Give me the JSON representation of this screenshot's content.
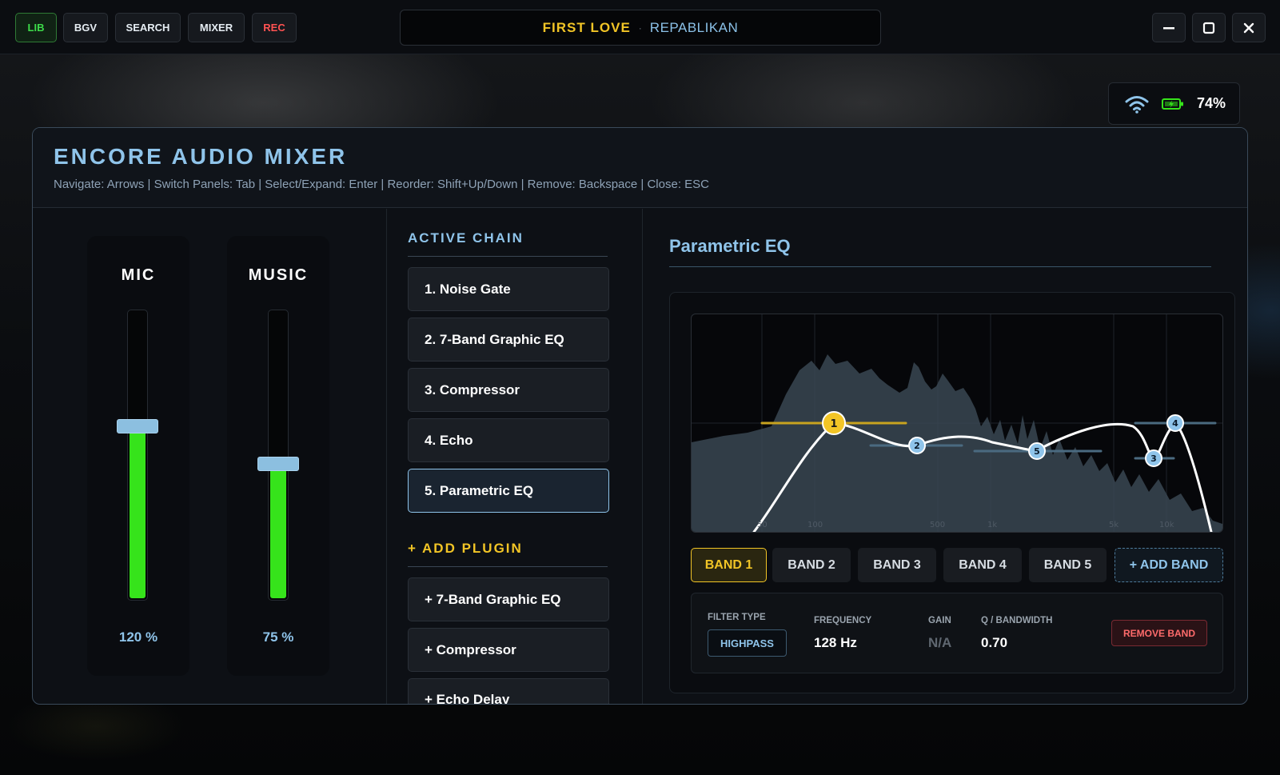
{
  "topbar": {
    "nav": [
      "LIB",
      "BGV",
      "SEARCH",
      "MIXER",
      "REC"
    ],
    "now_playing": {
      "title": "FIRST LOVE",
      "separator": "·",
      "artist": "REPABLIKAN"
    }
  },
  "status": {
    "battery_pct": "74%",
    "wifi_icon": "wifi-icon",
    "battery_icon": "battery-charging-icon"
  },
  "mixer": {
    "title": "ENCORE AUDIO MIXER",
    "help": "Navigate: Arrows | Switch Panels: Tab | Select/Expand: Enter | Reorder: Shift+Up/Down | Remove: Backspace | Close: ESC",
    "channels": [
      {
        "label": "MIC",
        "value": "120 %",
        "level": 0.6
      },
      {
        "label": "MUSIC",
        "value": "75 %",
        "level": 0.47
      }
    ],
    "active_chain": {
      "title": "ACTIVE CHAIN",
      "items": [
        "1. Noise Gate",
        "2. 7-Band Graphic EQ",
        "3. Compressor",
        "4. Echo",
        "5. Parametric EQ"
      ],
      "selected": 4
    },
    "add_plugin": {
      "title": "+ ADD PLUGIN",
      "items": [
        "+ 7-Band Graphic EQ",
        "+ Compressor",
        "+ Echo Delay"
      ]
    },
    "eq": {
      "title": "Parametric EQ",
      "freq_labels": [
        "50",
        "100",
        "500",
        "1k",
        "5k",
        "10k"
      ],
      "nodes": [
        "1",
        "2",
        "5",
        "3",
        "4"
      ],
      "bands": [
        "BAND 1",
        "BAND 2",
        "BAND 3",
        "BAND 4",
        "BAND 5"
      ],
      "add_band": "+ ADD BAND",
      "selected_band": 0,
      "detail": {
        "filter_type_label": "FILTER TYPE",
        "filter_type": "HIGHPASS",
        "frequency_label": "FREQUENCY",
        "frequency": "128 Hz",
        "gain_label": "GAIN",
        "gain": "N/A",
        "q_label": "Q / BANDWIDTH",
        "q": "0.70",
        "remove": "REMOVE BAND"
      }
    }
  },
  "colors": {
    "accent": "#8fc4ea",
    "active_band": "#f2c526",
    "meter": "#36e31b",
    "rec": "#ff5252",
    "lib": "#3ddc4a"
  }
}
